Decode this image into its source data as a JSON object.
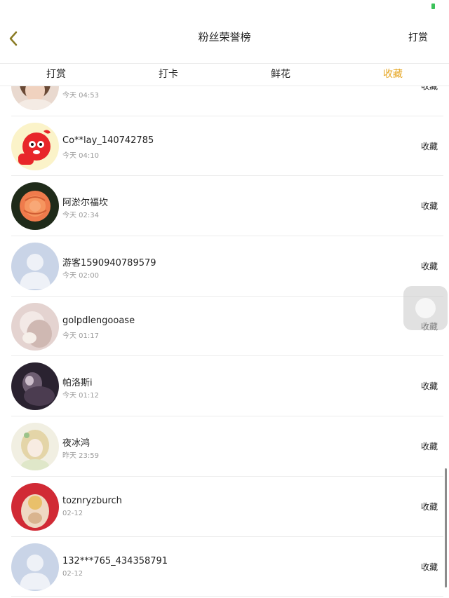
{
  "nav": {
    "title": "粉丝荣誉榜",
    "right_label": "打赏"
  },
  "tabs": [
    "打赏",
    "打卡",
    "鲜花",
    "收藏"
  ],
  "active_tab_index": 3,
  "accent_color": "#e6a623",
  "rows": [
    {
      "name": "",
      "time": "今天 04:53",
      "action": "收藏"
    },
    {
      "name": "Co**lay_140742785",
      "time": "今天 04:10",
      "action": "收藏"
    },
    {
      "name": "阿淤尔福坎",
      "time": "今天 02:34",
      "action": "收藏"
    },
    {
      "name": "游客1590940789579",
      "time": "今天 02:00",
      "action": "收藏"
    },
    {
      "name": "golpdlengooase",
      "time": "今天 01:17",
      "action": "收藏"
    },
    {
      "name": "帕洛斯i",
      "time": "今天 01:12",
      "action": "收藏"
    },
    {
      "name": "夜冰鸿",
      "time": "昨天 23:59",
      "action": "收藏"
    },
    {
      "name": "toznryzburch",
      "time": "02-12",
      "action": "收藏"
    },
    {
      "name": "132***765_434358791",
      "time": "02-12",
      "action": "收藏"
    }
  ]
}
